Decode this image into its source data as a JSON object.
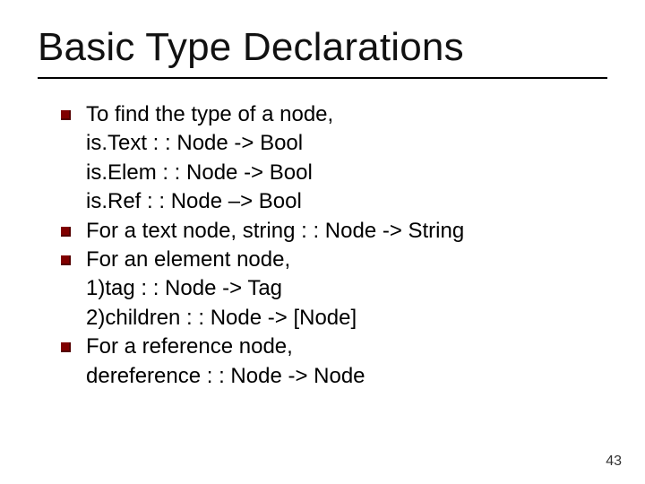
{
  "title": "Basic Type Declarations",
  "bullets": [
    {
      "lines": [
        "To find the type of a node,",
        "is.Text : : Node -> Bool",
        "is.Elem : : Node -> Bool",
        "is.Ref : : Node –> Bool"
      ]
    },
    {
      "lines": [
        "For a text node,  string : : Node -> String"
      ]
    },
    {
      "lines": [
        "For an element node,",
        "1)tag : : Node -> Tag",
        "2)children : : Node -> [Node]"
      ]
    },
    {
      "lines": [
        " For a reference node,",
        "dereference : : Node -> Node"
      ]
    }
  ],
  "page_number": "43"
}
